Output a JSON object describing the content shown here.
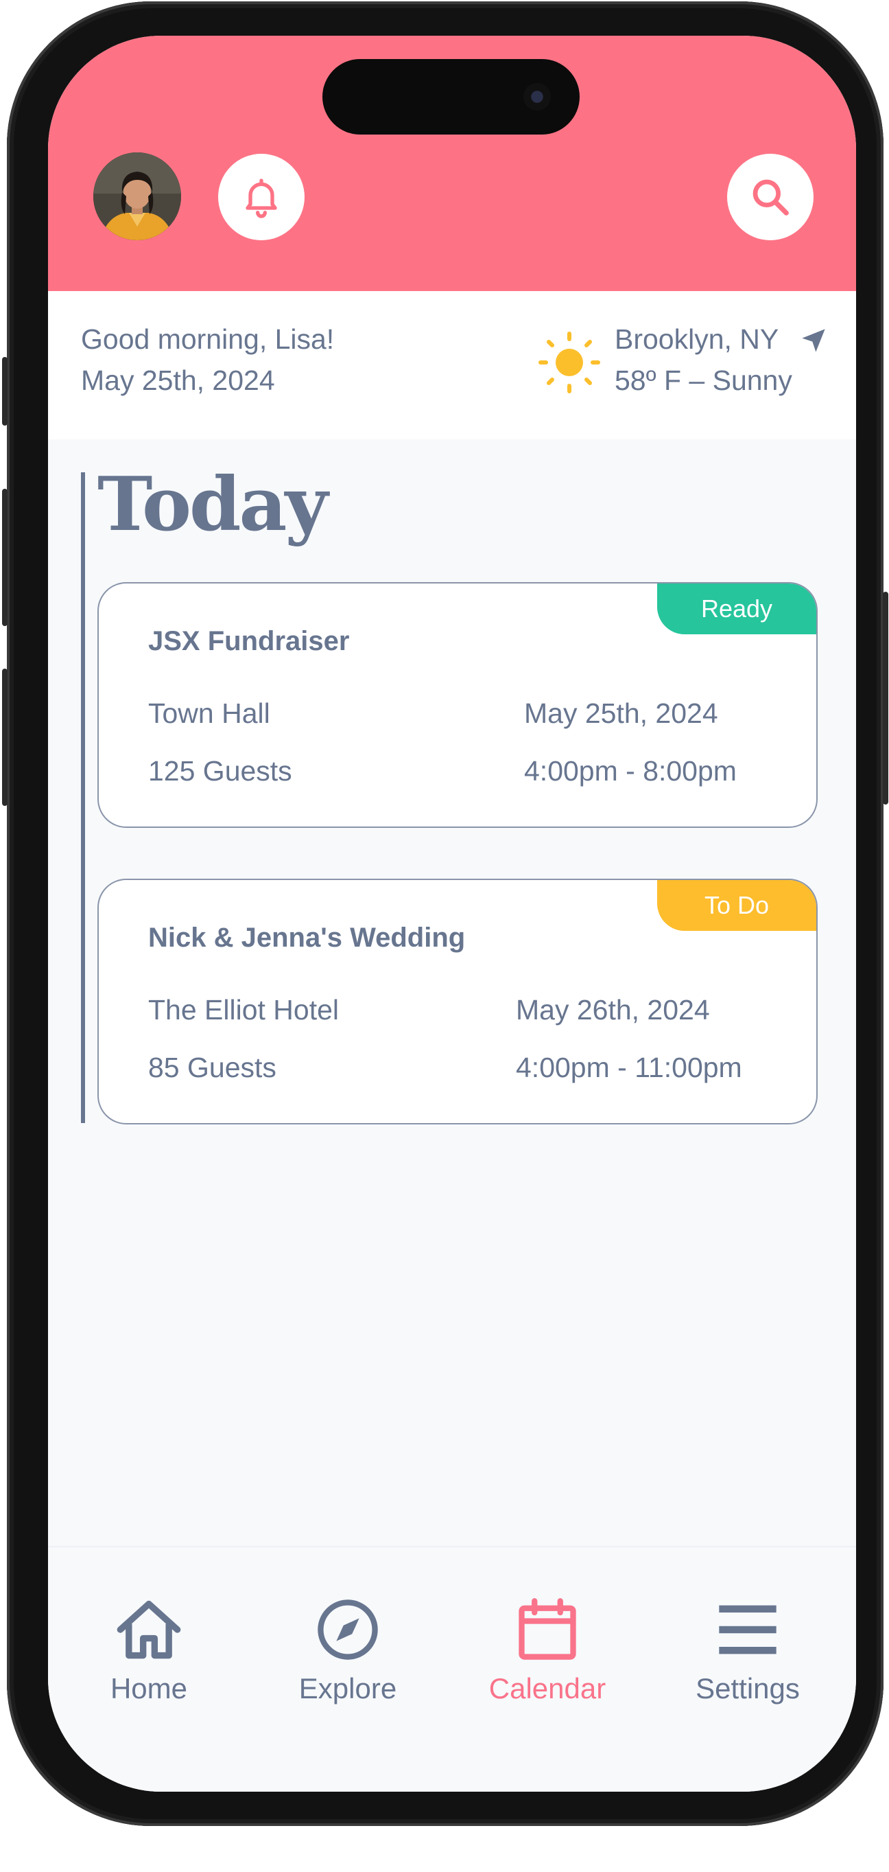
{
  "header": {
    "avatar_alt": "profile photo",
    "bell_icon": "bell-icon",
    "search_icon": "search-icon"
  },
  "greeting": {
    "line1": "Good morning, Lisa!",
    "line2": "May 25th, 2024"
  },
  "weather": {
    "location": "Brooklyn, NY",
    "forecast": "58º F – Sunny",
    "weather_icon": "sun-icon",
    "location_icon": "location-arrow-icon"
  },
  "section_title": "Today",
  "events": [
    {
      "title": "JSX Fundraiser",
      "venue": "Town Hall",
      "guests": "125 Guests",
      "date": "May 25th, 2024",
      "time": "4:00pm - 8:00pm",
      "status": "Ready",
      "status_color": "#26c59c"
    },
    {
      "title": "Nick & Jenna's Wedding",
      "venue": "The Elliot Hotel",
      "guests": "85 Guests",
      "date": "May 26th, 2024",
      "time": "4:00pm - 11:00pm",
      "status": "To Do",
      "status_color": "#fdbd2d"
    }
  ],
  "tabs": [
    {
      "label": "Home",
      "icon": "home-icon"
    },
    {
      "label": "Explore",
      "icon": "compass-icon"
    },
    {
      "label": "Calendar",
      "icon": "calendar-icon",
      "active": true
    },
    {
      "label": "Settings",
      "icon": "menu-icon"
    }
  ],
  "colors": {
    "brand": "#fd7385",
    "text": "#67758f",
    "active_tab": "#f9738a",
    "sun": "#fbbf2c"
  }
}
